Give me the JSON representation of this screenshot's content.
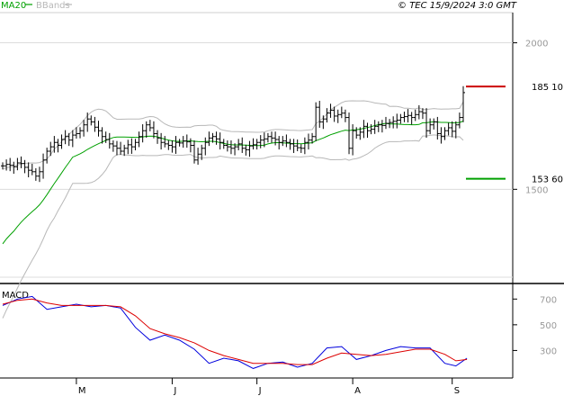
{
  "header": {
    "legend": [
      {
        "label": "MA20",
        "color": "#00a000"
      },
      {
        "label": "BBands",
        "color": "#b8b8b8"
      }
    ],
    "copyright": "© TEC 15/9/2024 3:0 GMT"
  },
  "colors": {
    "price_bars": "#000000",
    "ma20": "#00a000",
    "bbands": "#b8b8b8",
    "macd": "#0000dd",
    "signal": "#dd0000",
    "target_high": "#cc0000",
    "target_low": "#00a000",
    "axis_label": "#999999"
  },
  "chart_data": [
    {
      "type": "ohlc",
      "name": "price",
      "ylim": [
        1200,
        2100
      ],
      "y_ticks": [
        {
          "value": 2000,
          "label": "2000"
        },
        {
          "value": 1500,
          "label": "1500"
        }
      ],
      "x_ticks": [
        {
          "index": 20,
          "label": "M"
        },
        {
          "index": 46,
          "label": "J"
        },
        {
          "index": 69,
          "label": "J"
        },
        {
          "index": 95,
          "label": "A"
        },
        {
          "index": 122,
          "label": "S"
        }
      ],
      "closes": [
        1580,
        1585,
        1582,
        1577,
        1590,
        1588,
        1575,
        1565,
        1560,
        1545,
        1560,
        1600,
        1630,
        1645,
        1660,
        1650,
        1670,
        1680,
        1668,
        1685,
        1690,
        1700,
        1720,
        1740,
        1730,
        1712,
        1700,
        1680,
        1670,
        1655,
        1648,
        1640,
        1630,
        1640,
        1652,
        1645,
        1660,
        1680,
        1700,
        1720,
        1710,
        1690,
        1675,
        1660,
        1655,
        1650,
        1645,
        1660,
        1658,
        1665,
        1662,
        1650,
        1600,
        1620,
        1640,
        1660,
        1675,
        1680,
        1672,
        1660,
        1650,
        1645,
        1640,
        1645,
        1655,
        1640,
        1635,
        1648,
        1652,
        1660,
        1668,
        1672,
        1680,
        1675,
        1670,
        1660,
        1665,
        1660,
        1655,
        1648,
        1642,
        1640,
        1660,
        1668,
        1680,
        1780,
        1730,
        1740,
        1760,
        1770,
        1750,
        1755,
        1760,
        1745,
        1640,
        1700,
        1685,
        1695,
        1715,
        1700,
        1705,
        1715,
        1720,
        1718,
        1725,
        1728,
        1732,
        1736,
        1745,
        1748,
        1752,
        1745,
        1755,
        1765,
        1760,
        1700,
        1720,
        1730,
        1690,
        1680,
        1700,
        1710,
        1698,
        1720,
        1745,
        1830
      ],
      "targets": [
        {
          "label": "185 10",
          "value": 1851,
          "role": "high"
        },
        {
          "label": "153 60",
          "value": 1536,
          "role": "low"
        }
      ]
    },
    {
      "type": "line",
      "name": "MACD",
      "title": "MACD",
      "ylim": [
        100,
        800
      ],
      "y_ticks": [
        {
          "value": 700,
          "label": "700"
        },
        {
          "value": 500,
          "label": "500"
        },
        {
          "value": 300,
          "label": "300"
        }
      ],
      "x": [
        0,
        4,
        8,
        12,
        16,
        20,
        24,
        28,
        32,
        36,
        40,
        44,
        48,
        52,
        56,
        60,
        64,
        68,
        72,
        76,
        80,
        84,
        88,
        92,
        96,
        100,
        104,
        108,
        112,
        116,
        120,
        123,
        126
      ],
      "series": [
        {
          "role": "macd",
          "values": [
            650,
            700,
            720,
            620,
            640,
            660,
            640,
            650,
            630,
            480,
            380,
            420,
            380,
            310,
            200,
            240,
            220,
            160,
            200,
            210,
            170,
            200,
            320,
            330,
            230,
            260,
            300,
            330,
            320,
            320,
            200,
            180,
            240
          ]
        },
        {
          "role": "signal",
          "values": [
            660,
            690,
            700,
            670,
            650,
            650,
            650,
            650,
            640,
            570,
            470,
            430,
            400,
            360,
            300,
            260,
            230,
            200,
            200,
            200,
            190,
            190,
            240,
            280,
            270,
            260,
            270,
            290,
            310,
            310,
            270,
            220,
            230
          ]
        }
      ]
    }
  ]
}
